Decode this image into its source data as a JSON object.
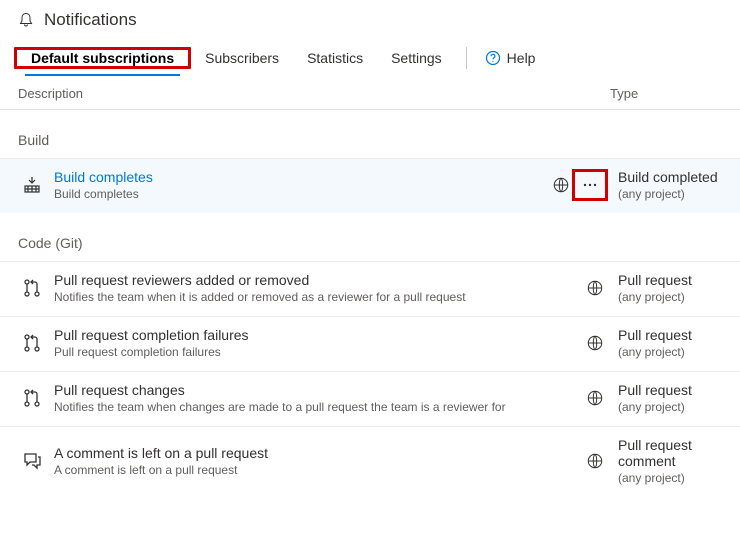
{
  "header": {
    "title": "Notifications"
  },
  "tabs": {
    "items": [
      {
        "label": "Default subscriptions"
      },
      {
        "label": "Subscribers"
      },
      {
        "label": "Statistics"
      },
      {
        "label": "Settings"
      }
    ],
    "help_label": "Help"
  },
  "columns": {
    "description": "Description",
    "type": "Type"
  },
  "groups": [
    {
      "label": "Build",
      "rows": [
        {
          "icon": "build",
          "title": "Build completes",
          "title_link": true,
          "subtitle": "Build completes",
          "highlight": true,
          "show_more": true,
          "type_title": "Build completed",
          "type_sub": "(any project)"
        }
      ]
    },
    {
      "label": "Code (Git)",
      "rows": [
        {
          "icon": "pr",
          "title": "Pull request reviewers added or removed",
          "subtitle": "Notifies the team when it is added or removed as a reviewer for a pull request",
          "type_title": "Pull request",
          "type_sub": "(any project)"
        },
        {
          "icon": "pr",
          "title": "Pull request completion failures",
          "subtitle": "Pull request completion failures",
          "type_title": "Pull request",
          "type_sub": "(any project)"
        },
        {
          "icon": "pr",
          "title": "Pull request changes",
          "subtitle": "Notifies the team when changes are made to a pull request the team is a reviewer for",
          "type_title": "Pull request",
          "type_sub": "(any project)"
        },
        {
          "icon": "comment",
          "title": "A comment is left on a pull request",
          "subtitle": "A comment is left on a pull request",
          "type_title": "Pull request comment",
          "type_sub": "(any project)"
        }
      ]
    }
  ]
}
